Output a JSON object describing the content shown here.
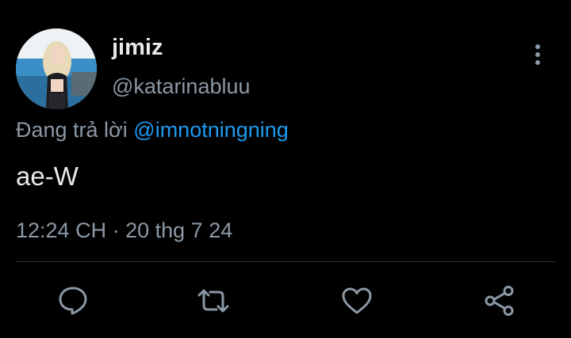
{
  "tweet": {
    "display_name": "jimiz",
    "handle": "@katarinabluu",
    "reply_prefix": "Đang trả lời",
    "reply_to": "@imnotningning",
    "text": "ae-W",
    "time": "12:24 CH",
    "separator": "·",
    "date": "20 thg 7 24"
  },
  "actions": {
    "reply_icon": "comment-bubble-icon",
    "retweet_icon": "retweet-arrows-icon",
    "like_icon": "heart-icon",
    "share_icon": "share-nodes-icon"
  },
  "colors": {
    "background": "#000000",
    "primary_text": "#e7e9ea",
    "secondary_text": "#8b98a5",
    "link": "#1d9bf0",
    "divider": "#2f3336"
  }
}
